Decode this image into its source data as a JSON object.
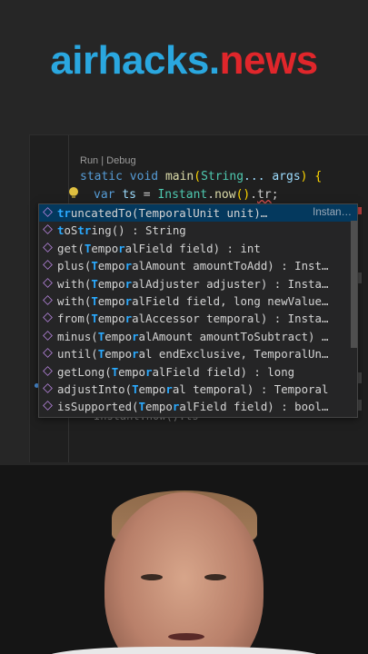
{
  "banner": {
    "part1": "airhacks",
    "part2": ".",
    "part3": "news"
  },
  "editor": {
    "codelens": "Run | Debug",
    "line1": {
      "kw1": "static",
      "kw2": "void",
      "fn": "main",
      "paren_open": "(",
      "type": "String",
      "rest": "... args",
      "paren_close": ")",
      "brace": "{"
    },
    "line2": {
      "kw": "var",
      "var": "ts",
      "eq": " = ",
      "type": "Instant",
      "dot1": ".",
      "fn": "now",
      "parens": "()",
      "dot2": ".",
      "typed": "tr",
      "semi": ";"
    },
    "background_line": "Instant.now().ts"
  },
  "suggestions": [
    {
      "parts": [
        [
          "hl",
          "tr"
        ],
        [
          "n",
          "uncatedTo(TemporalUnit unit)…"
        ]
      ],
      "detail": "Instan…",
      "selected": true
    },
    {
      "parts": [
        [
          "hl",
          "t"
        ],
        [
          "n",
          "oS"
        ],
        [
          "hl",
          "tr"
        ],
        [
          "n",
          "ing() : String"
        ]
      ],
      "detail": ""
    },
    {
      "parts": [
        [
          "n",
          "get("
        ],
        [
          "hl",
          "T"
        ],
        [
          "n",
          "empo"
        ],
        [
          "hl",
          "r"
        ],
        [
          "n",
          "alField field) : int"
        ]
      ],
      "detail": ""
    },
    {
      "parts": [
        [
          "n",
          "plus("
        ],
        [
          "hl",
          "T"
        ],
        [
          "n",
          "empo"
        ],
        [
          "hl",
          "r"
        ],
        [
          "n",
          "alAmount amountToAdd) : Inst…"
        ]
      ],
      "detail": ""
    },
    {
      "parts": [
        [
          "n",
          "with("
        ],
        [
          "hl",
          "T"
        ],
        [
          "n",
          "empo"
        ],
        [
          "hl",
          "r"
        ],
        [
          "n",
          "alAdjuster adjuster) : Insta…"
        ]
      ],
      "detail": ""
    },
    {
      "parts": [
        [
          "n",
          "with("
        ],
        [
          "hl",
          "T"
        ],
        [
          "n",
          "empo"
        ],
        [
          "hl",
          "r"
        ],
        [
          "n",
          "alField field, long newValue…"
        ]
      ],
      "detail": ""
    },
    {
      "parts": [
        [
          "n",
          "from("
        ],
        [
          "hl",
          "T"
        ],
        [
          "n",
          "empo"
        ],
        [
          "hl",
          "r"
        ],
        [
          "n",
          "alAccessor temporal) : Insta…"
        ]
      ],
      "detail": ""
    },
    {
      "parts": [
        [
          "n",
          "minus("
        ],
        [
          "hl",
          "T"
        ],
        [
          "n",
          "empo"
        ],
        [
          "hl",
          "r"
        ],
        [
          "n",
          "alAmount amountToSubtract) …"
        ]
      ],
      "detail": ""
    },
    {
      "parts": [
        [
          "n",
          "until("
        ],
        [
          "hl",
          "T"
        ],
        [
          "n",
          "empo"
        ],
        [
          "hl",
          "r"
        ],
        [
          "n",
          "al endExclusive, TemporalUn…"
        ]
      ],
      "detail": ""
    },
    {
      "parts": [
        [
          "n",
          "getLong("
        ],
        [
          "hl",
          "T"
        ],
        [
          "n",
          "empo"
        ],
        [
          "hl",
          "r"
        ],
        [
          "n",
          "alField field) : long"
        ]
      ],
      "detail": ""
    },
    {
      "parts": [
        [
          "n",
          "adjustInto("
        ],
        [
          "hl",
          "T"
        ],
        [
          "n",
          "empo"
        ],
        [
          "hl",
          "r"
        ],
        [
          "n",
          "al temporal) : Temporal"
        ]
      ],
      "detail": ""
    },
    {
      "parts": [
        [
          "n",
          "isSupported("
        ],
        [
          "hl",
          "T"
        ],
        [
          "n",
          "empo"
        ],
        [
          "hl",
          "r"
        ],
        [
          "n",
          "alField field) : bool…"
        ]
      ],
      "detail": ""
    }
  ],
  "colors": {
    "brand_blue": "#2aa7df",
    "brand_red": "#e0262b",
    "selection": "#04395e",
    "match_highlight": "#2aaaff"
  }
}
